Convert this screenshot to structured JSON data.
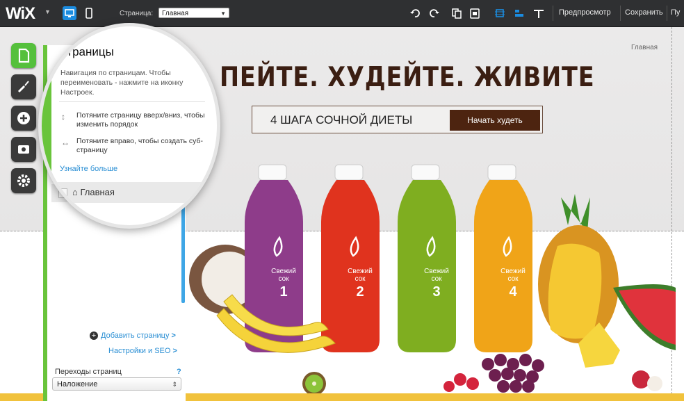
{
  "topbar": {
    "logo": "WiX",
    "page_label": "Страница:",
    "page_value": "Главная",
    "preview": "Предпросмотр",
    "save": "Сохранить",
    "publish_partial": "Пу"
  },
  "canvas": {
    "breadcrumb": "Главная",
    "headline": "ПЕЙТЕ. ХУДЕЙТЕ. ЖИВИТЕ",
    "cta_text": "4 ШАГА СОЧНОЙ ДИЕТЫ",
    "cta_button": "Начать худеть",
    "bottles": [
      {
        "label1": "Свежий",
        "label2": "сок",
        "num": "1",
        "color": "#8e3c8a"
      },
      {
        "label1": "Свежий",
        "label2": "сок",
        "num": "2",
        "color": "#e0331e"
      },
      {
        "label1": "Свежий",
        "label2": "сок",
        "num": "3",
        "color": "#7fae20"
      },
      {
        "label1": "Свежий",
        "label2": "сок",
        "num": "4",
        "color": "#f0a418"
      }
    ]
  },
  "pages_panel": {
    "title": "Страницы",
    "description": "Навигация по страницам. Чтобы переименовать - нажмите на иконку Настроек.",
    "hint1": "Потяните страницу вверх/вниз, чтобы изменить порядок",
    "hint2": "Потяните вправо, чтобы создать суб-страницу",
    "learn_more": "Узнайте больше",
    "page_item": "Главная",
    "add_page": "Добавить страницу",
    "add_page_arrow": ">",
    "settings_seo": "Настройки и SEO",
    "settings_seo_arrow": ">",
    "transitions_label": "Переходы страниц",
    "transitions_help": "?",
    "transitions_value": "Наложение"
  },
  "colors": {
    "accent_green": "#69c43b",
    "link_blue": "#2b8fd4",
    "headline_brown": "#3b1e12",
    "cta_brown": "#4d2410"
  }
}
